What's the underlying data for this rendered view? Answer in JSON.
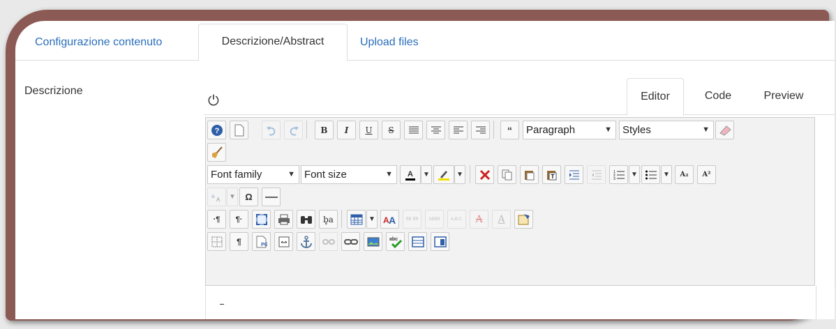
{
  "tabs": {
    "config": "Configurazione contenuto",
    "desc": "Descrizione/Abstract",
    "upload": "Upload files"
  },
  "field_label": "Descrizione",
  "editor_modes": {
    "editor": "Editor",
    "code": "Code",
    "preview": "Preview"
  },
  "toolbar": {
    "format_select": "Paragraph",
    "styles_select": "Styles",
    "font_family": "Font family",
    "font_size": "Font size"
  },
  "glyphs": {
    "bold": "B",
    "italic": "I",
    "underline": "U",
    "strike": "S",
    "blockquote": "“",
    "omega": "Ω",
    "subscript": "A₂",
    "superscript": "A²",
    "pilcrow": "¶",
    "ba": "b̥a",
    "abc": "abc",
    "abbr": "ABBR",
    "abc_dots": "A.B.C.",
    "quote_glyph": "66 99",
    "font_color_letter": "A"
  },
  "colors": {
    "accent": "#2a6ebb",
    "frame": "#8b5a55"
  }
}
